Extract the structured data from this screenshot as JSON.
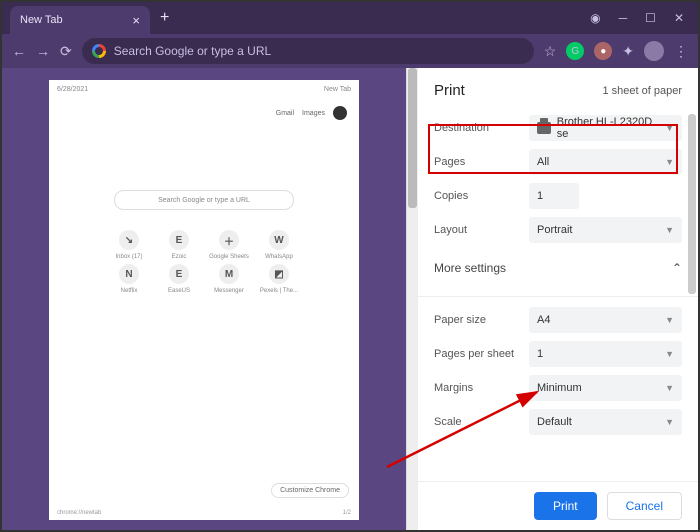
{
  "tab": {
    "title": "New Tab"
  },
  "omnibox": {
    "placeholder": "Search Google or type a URL"
  },
  "preview": {
    "date": "6/28/2021",
    "title": "New Tab",
    "links": [
      "Gmail",
      "Images"
    ],
    "search_placeholder": "Search Google or type a URL",
    "shortcuts": [
      {
        "icon": "↘",
        "label": "Inbox (17)"
      },
      {
        "icon": "E",
        "label": "Ezoic"
      },
      {
        "icon": "＋",
        "label": "Google Sheets"
      },
      {
        "icon": "W",
        "label": "WhatsApp"
      },
      {
        "icon": "N",
        "label": "Netflix"
      },
      {
        "icon": "E",
        "label": "EaseUS"
      },
      {
        "icon": "M",
        "label": "Messenger"
      },
      {
        "icon": "◩",
        "label": "Pexels | The..."
      }
    ],
    "customize": "Customize Chrome",
    "footer_url": "chrome://newtab",
    "footer_page": "1/2"
  },
  "print": {
    "title": "Print",
    "sheets": "1 sheet of paper",
    "labels": {
      "destination": "Destination",
      "pages": "Pages",
      "copies": "Copies",
      "layout": "Layout",
      "more": "More settings",
      "paper_size": "Paper size",
      "pages_per_sheet": "Pages per sheet",
      "margins": "Margins",
      "scale": "Scale"
    },
    "values": {
      "destination": "Brother HL-L2320D se",
      "pages": "All",
      "copies": "1",
      "layout": "Portrait",
      "paper_size": "A4",
      "pages_per_sheet": "1",
      "margins": "Minimum",
      "scale": "Default"
    },
    "buttons": {
      "print": "Print",
      "cancel": "Cancel"
    }
  }
}
